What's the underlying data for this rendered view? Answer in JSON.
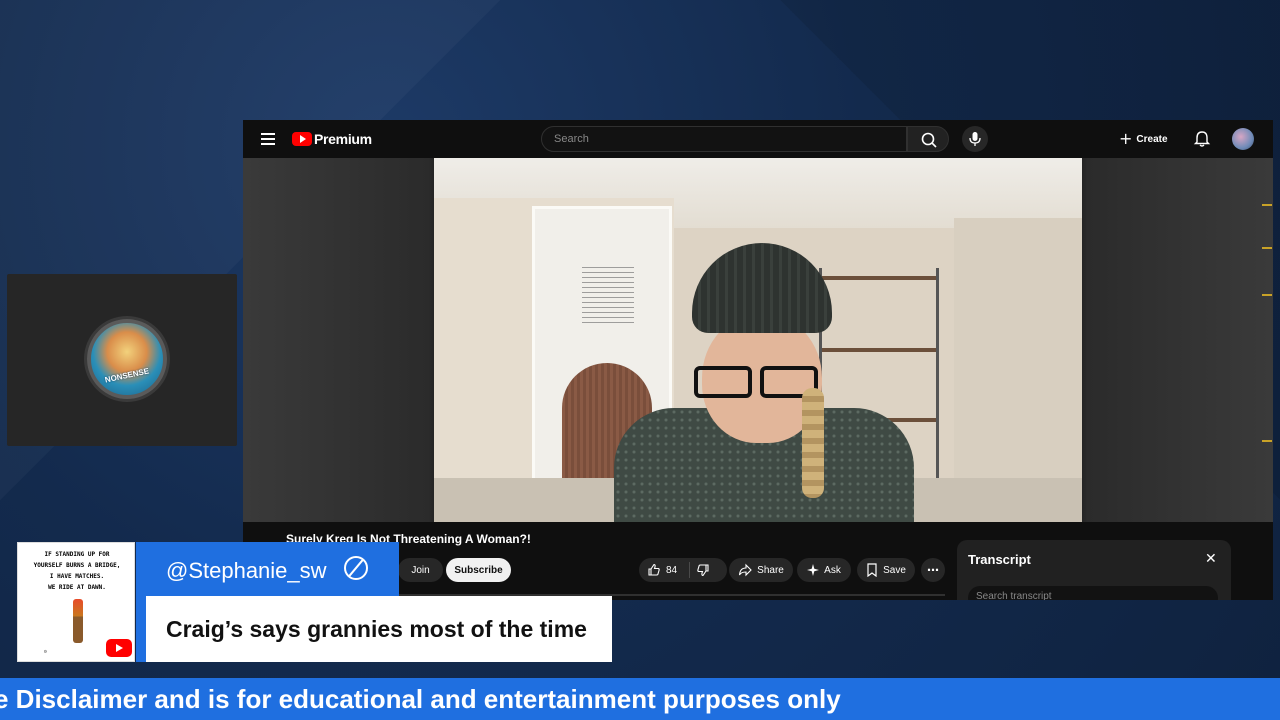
{
  "youtube": {
    "brand": "Premium",
    "search_placeholder": "Search",
    "create_label": "Create",
    "video_title": "Surely Kreg Is Not Threatening A Woman?!",
    "buttons": {
      "join": "Join",
      "subscribe": "Subscribe",
      "like_count": "84",
      "share": "Share",
      "ask": "Ask",
      "save": "Save"
    },
    "transcript": {
      "title": "Transcript",
      "search_placeholder": "Search transcript"
    }
  },
  "overlay": {
    "thumb_text": "IF STANDING UP FOR\nYOURSELF BURNS A BRIDGE,\nI HAVE MATCHES.\nWE RIDE AT DAWN.",
    "username": "@Stephanie_sw",
    "comment": "Craig’s says grannies most of the time",
    "cam_badge": "NONSENSE"
  },
  "ticker": {
    "text": "e Disclaimer and is for educational and entertainment purposes only"
  },
  "colors": {
    "accent_blue": "#1f6fe0",
    "youtube_red": "#ff0000",
    "background": "#13294a"
  }
}
